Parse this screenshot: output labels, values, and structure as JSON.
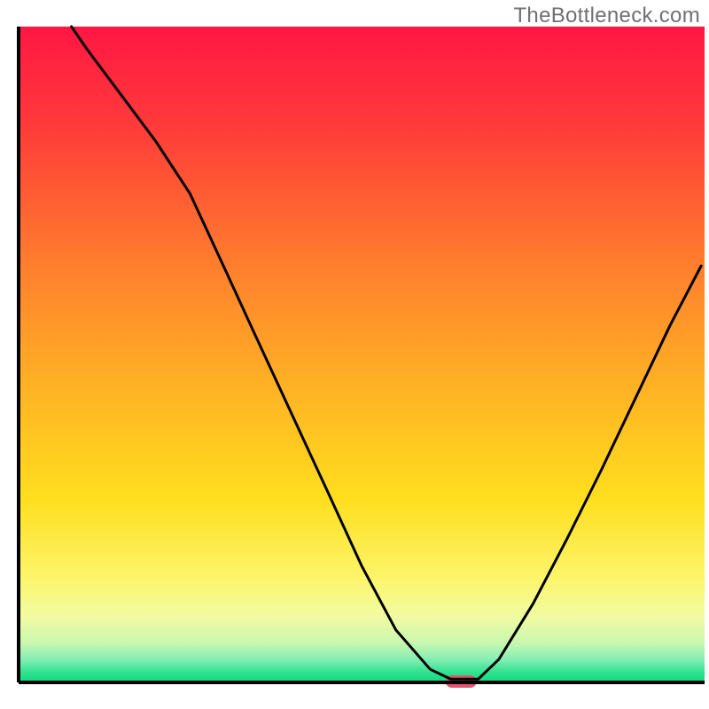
{
  "attribution": "TheBottleneck.com",
  "chart_data": {
    "type": "line",
    "title": "",
    "xlabel": "",
    "ylabel": "",
    "xlim": [
      0,
      100
    ],
    "ylim": [
      0,
      100
    ],
    "x": [
      7.7,
      10,
      15,
      20,
      25,
      30,
      35,
      40,
      45,
      50,
      55,
      60,
      63,
      65,
      67,
      70,
      75,
      80,
      85,
      90,
      95,
      99.5
    ],
    "values": [
      100,
      96.5,
      89.5,
      82.5,
      74.5,
      63.2,
      51.8,
      40.5,
      29.2,
      17.8,
      8.0,
      2.0,
      0.5,
      0.5,
      0.5,
      3.5,
      12.0,
      22.0,
      32.5,
      43.5,
      54.5,
      63.5
    ],
    "background": {
      "type": "vertical-gradient",
      "stops": [
        {
          "pos": 0.0,
          "color": "#ff1744"
        },
        {
          "pos": 0.15,
          "color": "#ff3a3a"
        },
        {
          "pos": 0.35,
          "color": "#ff7a2e"
        },
        {
          "pos": 0.55,
          "color": "#ffb224"
        },
        {
          "pos": 0.72,
          "color": "#ffde1e"
        },
        {
          "pos": 0.84,
          "color": "#fdf56a"
        },
        {
          "pos": 0.9,
          "color": "#f1fba1"
        },
        {
          "pos": 0.94,
          "color": "#c9f7b0"
        },
        {
          "pos": 0.965,
          "color": "#84eeb4"
        },
        {
          "pos": 0.985,
          "color": "#2fe28e"
        },
        {
          "pos": 1.0,
          "color": "#11d981"
        }
      ]
    },
    "marker": {
      "x": 64.5,
      "y": 0,
      "color": "#e2546d",
      "width_frac": 0.045,
      "height_frac": 0.019
    },
    "axis_line_color": "#000000",
    "axis_line_width": 4,
    "curve_color": "#000000",
    "curve_width": 3
  }
}
